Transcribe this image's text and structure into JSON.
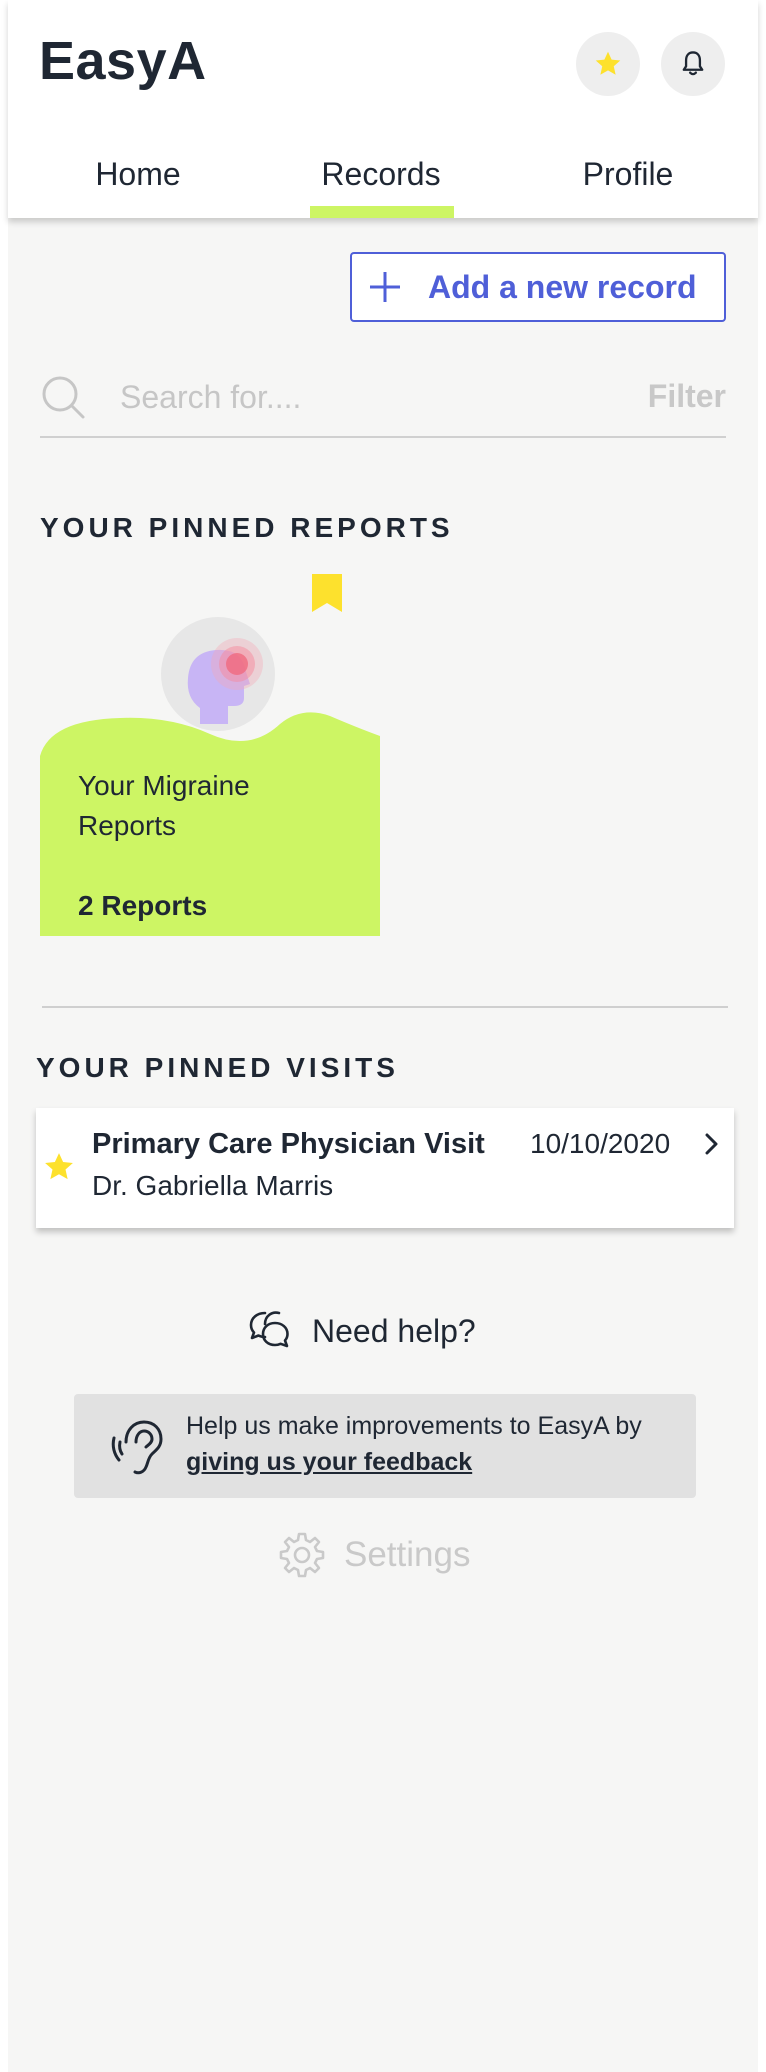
{
  "app": {
    "name": "EasyA"
  },
  "tabs": [
    {
      "label": "Home"
    },
    {
      "label": "Records"
    },
    {
      "label": "Profile"
    }
  ],
  "active_tab": "Records",
  "actions": {
    "add_record": "Add a new record"
  },
  "search": {
    "placeholder": "Search for....",
    "filter_label": "Filter"
  },
  "pinned_reports": {
    "title": "YOUR PINNED REPORTS",
    "items": [
      {
        "name": "Your Migraine Reports",
        "count": "2 Reports",
        "icon": "head-migraine-icon",
        "pinned": true
      }
    ]
  },
  "pinned_visits": {
    "title": "YOUR PINNED VISITS",
    "items": [
      {
        "title": "Primary Care Physician Visit",
        "doctor": "Dr. Gabriella Marris",
        "date": "10/10/2020",
        "starred": true
      }
    ]
  },
  "help": {
    "label": "Need help?"
  },
  "feedback": {
    "text": "Help us make improvements to EasyA by",
    "link": "giving us your feedback"
  },
  "settings": {
    "label": "Settings"
  },
  "colors": {
    "accent_green": "#cdf564",
    "accent_blue": "#4f5fd8",
    "star_yellow": "#fde12d",
    "text_dark": "#1f2733",
    "background": "#f6f6f5"
  }
}
